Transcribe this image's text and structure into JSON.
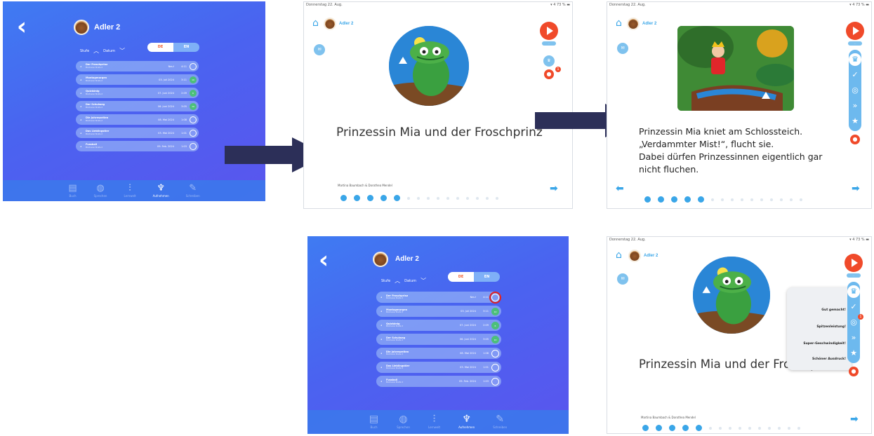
{
  "accent": "#3aa6e8",
  "record_color": "#f04a2a",
  "list_screen": {
    "user": "Adler 2",
    "sort_level": "Stufe",
    "sort_date": "Datum",
    "toggle": [
      "DE",
      "EN"
    ],
    "rows": [
      {
        "title": "Der Froschprinz",
        "sub": "Bücherei Stufe 2",
        "date": "Neu!",
        "hit": "14:02",
        "min": "Gehört",
        "val": "4:11",
        "count": ""
      },
      {
        "title": "Montagmorgen",
        "sub": "Bücherei Stufe 2",
        "date": "03. Juli 2024",
        "hit": "13:19",
        "min": "Gehört",
        "val": "3:11",
        "count": "10"
      },
      {
        "title": "Quizkönig",
        "sub": "Bücherei Stufe 2",
        "date": "07. Juni 2024",
        "hit": "11:12",
        "min": "Gehört",
        "val": "2:09",
        "count": "6"
      },
      {
        "title": "Der Schulweg",
        "sub": "Bücherei Stufe 2",
        "date": "06. Juni 2024",
        "hit": "10:01",
        "min": "Gehört",
        "val": "3:05",
        "count": "10"
      },
      {
        "title": "Die Jahreszeiten",
        "sub": "Bücherei Stufe 2",
        "date": "08. Mai 2024",
        "hit": "10:02",
        "min": "Gehört",
        "val": "1:08",
        "count": ""
      },
      {
        "title": "Das Lieblingstier",
        "sub": "Bücherei Stufe 2",
        "date": "03. Mai 2024",
        "hit": "10:03",
        "min": "Gehört",
        "val": "1:01",
        "count": ""
      },
      {
        "title": "Fussball",
        "sub": "Bücherei Stufe 2",
        "date": "09. Feb. 2024",
        "hit": "10:05",
        "min": "Gehört",
        "val": "1:03",
        "count": ""
      }
    ],
    "nav": [
      {
        "label": "Buch",
        "icon": "book"
      },
      {
        "label": "Sprechen",
        "icon": "speech"
      },
      {
        "label": "Lernwelt",
        "icon": "chart"
      },
      {
        "label": "Aufnehmen",
        "icon": "mic"
      },
      {
        "label": "Schreiben",
        "icon": "pen"
      }
    ]
  },
  "reader": {
    "user": "Adler 2",
    "status_time": "09:35",
    "status_date": "Donnerstag 22. Aug.",
    "status_right": "▾ 4 73 % ▬",
    "book_title": "Prinzessin Mia und der Froschprinz",
    "authors": "Martina Baumbach & Dorothea Mendel",
    "story_lines": [
      "Prinzessin Mia kniet am Schlossteich.",
      "„Verdammter Mist!“, flucht sie.",
      "Dabei dürfen Prinzessinnen eigentlich gar",
      "nicht fluchen."
    ],
    "badge": "1",
    "popup": [
      "Gut gemacht!",
      "Spitzenleistung!",
      "Super-Geschwindigkeit!",
      "Schöner Ausdruck!"
    ]
  }
}
